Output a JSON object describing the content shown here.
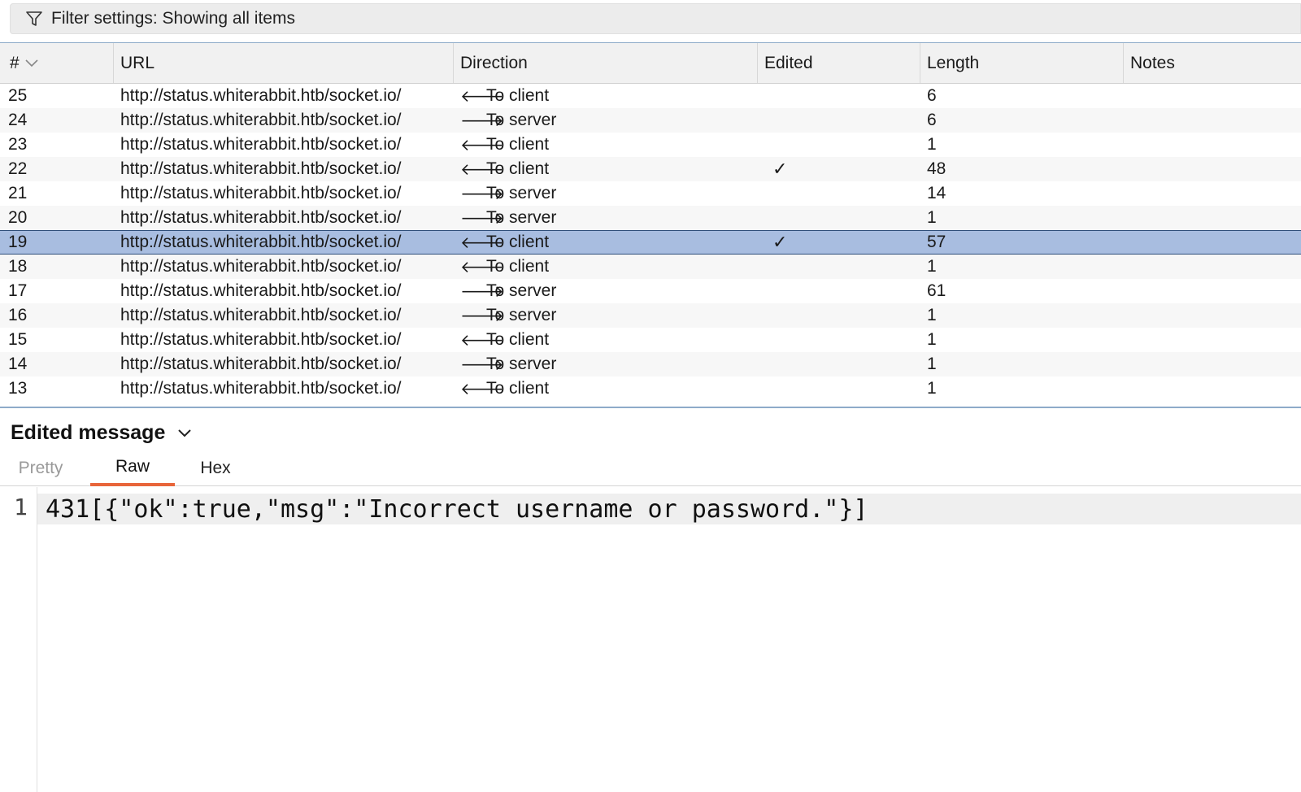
{
  "filter": {
    "label": "Filter settings: Showing all items"
  },
  "table": {
    "columns": {
      "num": "#",
      "url": "URL",
      "direction": "Direction",
      "edited": "Edited",
      "length": "Length",
      "notes": "Notes"
    },
    "rows": [
      {
        "num": "25",
        "url": "http://status.whiterabbit.htb/socket.io/",
        "arrow": "🡐",
        "direction": "To client",
        "edited": "",
        "length": "6"
      },
      {
        "num": "24",
        "url": "http://status.whiterabbit.htb/socket.io/",
        "arrow": "🡒",
        "direction": "To server",
        "edited": "",
        "length": "6"
      },
      {
        "num": "23",
        "url": "http://status.whiterabbit.htb/socket.io/",
        "arrow": "🡐",
        "direction": "To client",
        "edited": "",
        "length": "1"
      },
      {
        "num": "22",
        "url": "http://status.whiterabbit.htb/socket.io/",
        "arrow": "🡐",
        "direction": "To client",
        "edited": "✓",
        "length": "48"
      },
      {
        "num": "21",
        "url": "http://status.whiterabbit.htb/socket.io/",
        "arrow": "🡒",
        "direction": "To server",
        "edited": "",
        "length": "14"
      },
      {
        "num": "20",
        "url": "http://status.whiterabbit.htb/socket.io/",
        "arrow": "🡒",
        "direction": "To server",
        "edited": "",
        "length": "1"
      },
      {
        "num": "19",
        "url": "http://status.whiterabbit.htb/socket.io/",
        "arrow": "🡐",
        "direction": "To client",
        "edited": "✓",
        "length": "57"
      },
      {
        "num": "18",
        "url": "http://status.whiterabbit.htb/socket.io/",
        "arrow": "🡐",
        "direction": "To client",
        "edited": "",
        "length": "1"
      },
      {
        "num": "17",
        "url": "http://status.whiterabbit.htb/socket.io/",
        "arrow": "🡒",
        "direction": "To server",
        "edited": "",
        "length": "61"
      },
      {
        "num": "16",
        "url": "http://status.whiterabbit.htb/socket.io/",
        "arrow": "🡒",
        "direction": "To server",
        "edited": "",
        "length": "1"
      },
      {
        "num": "15",
        "url": "http://status.whiterabbit.htb/socket.io/",
        "arrow": "🡐",
        "direction": "To client",
        "edited": "",
        "length": "1"
      },
      {
        "num": "14",
        "url": "http://status.whiterabbit.htb/socket.io/",
        "arrow": "🡒",
        "direction": "To server",
        "edited": "",
        "length": "1"
      },
      {
        "num": "13",
        "url": "http://status.whiterabbit.htb/socket.io/",
        "arrow": "🡐",
        "direction": "To client",
        "edited": "",
        "length": "1"
      }
    ]
  },
  "message": {
    "title": "Edited message",
    "tabs": {
      "pretty": "Pretty",
      "raw": "Raw",
      "hex": "Hex"
    },
    "line_number": "1",
    "content": "431[{\"ok\":true,\"msg\":\"Incorrect username or password.\"}]"
  },
  "colors": {
    "selected_row": "#a8bde0",
    "active_tab": "#e8653a"
  }
}
